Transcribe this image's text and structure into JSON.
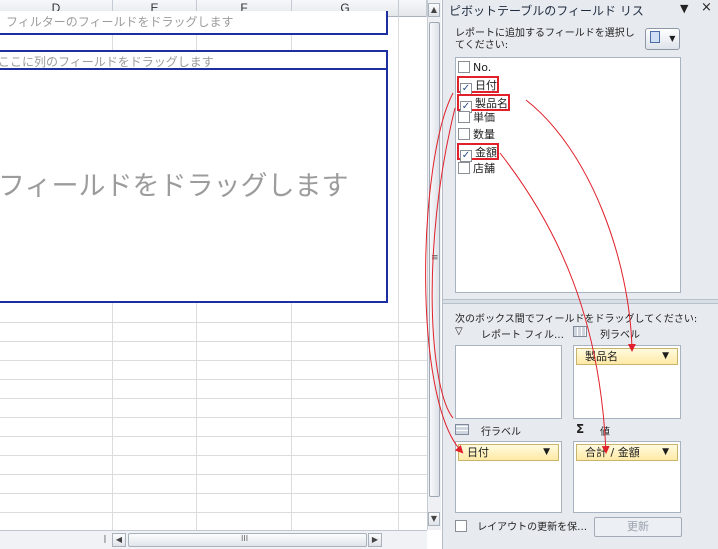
{
  "sheet": {
    "columns": [
      "D",
      "E",
      "F",
      "G"
    ],
    "filter_hint": "フィルターのフィールドをドラッグします",
    "column_hint": "ここに列のフィールドをドラッグします",
    "data_hint": "フィールドをドラッグします",
    "vscroll_grip": "≡",
    "hscroll_grip": "III"
  },
  "pane": {
    "title": "ピボットテーブルのフィールド リス",
    "dropdown_icon": "▼",
    "close_icon": "×",
    "choose_text": "レポートに追加するフィールドを選択してください:",
    "fields": [
      {
        "label": "No.",
        "checked": false
      },
      {
        "label": "日付",
        "checked": true
      },
      {
        "label": "製品名",
        "checked": true
      },
      {
        "label": "単価",
        "checked": false
      },
      {
        "label": "数量",
        "checked": false
      },
      {
        "label": "金額",
        "checked": true
      },
      {
        "label": "店舗",
        "checked": false
      }
    ],
    "drag_text": "次のボックス間でフィールドをドラッグしてください:",
    "areas": {
      "report_filter": "レポート フィル…",
      "column_labels": "列ラベル",
      "row_labels": "行ラベル",
      "values": "値"
    },
    "column_item": "製品名",
    "row_item": "日付",
    "value_item": "合計 / 金額",
    "defer_update_label": "レイアウトの更新を保…",
    "update_button": "更新",
    "accent_color": "#1d2ea0",
    "highlight_color": "#e0202a"
  }
}
